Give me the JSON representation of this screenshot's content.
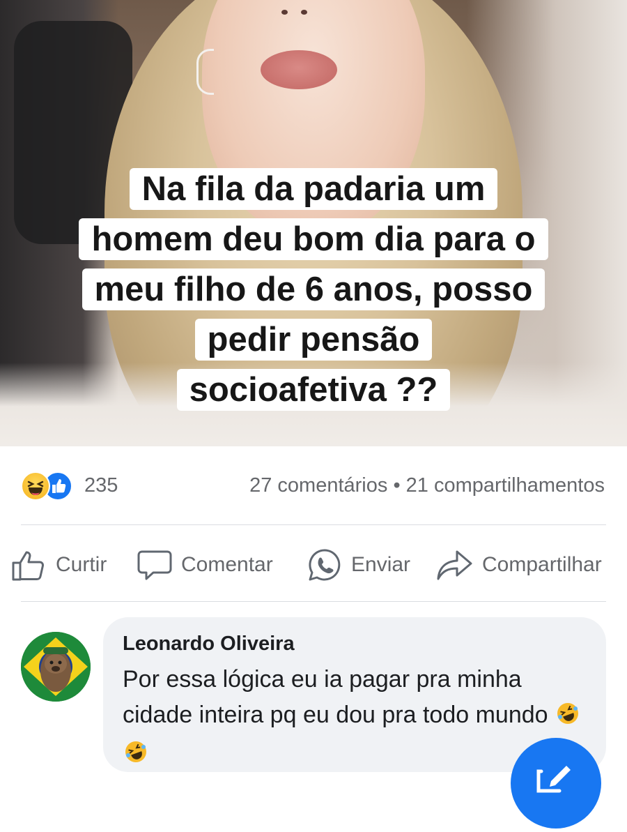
{
  "post": {
    "caption_lines": [
      "Na fila da padaria um",
      "homem deu bom dia para o",
      "meu filho de 6 anos, posso",
      "pedir pensão",
      "socioafetiva ??"
    ]
  },
  "stats": {
    "reactions": [
      "haha-emoji-icon",
      "like-thumb-icon"
    ],
    "reaction_count": "235",
    "comments": "27 comentários",
    "separator": "•",
    "shares": "21 compartilhamentos"
  },
  "actions": {
    "like": "Curtir",
    "comment": "Comentar",
    "send": "Enviar",
    "share": "Compartilhar"
  },
  "comment": {
    "author": "Leonardo Oliveira",
    "text": "Por essa lógica eu ia pagar pra minha cidade inteira pq eu dou pra todo mundo",
    "emojis": [
      "rolling-laughing-emoji",
      "rolling-laughing-emoji"
    ]
  },
  "colors": {
    "accent": "#1877f2",
    "muted_text": "#65676b",
    "bubble": "#f0f2f5",
    "divider": "#dadde1"
  }
}
